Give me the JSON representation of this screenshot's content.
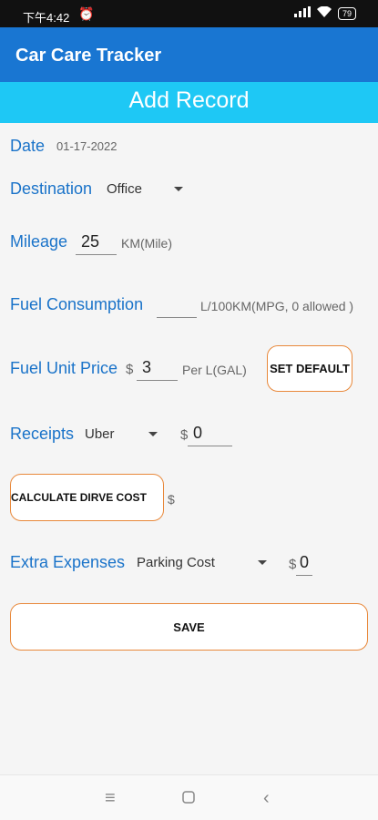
{
  "status_bar": {
    "time": "下午4:42",
    "alarm_icon": "⏰",
    "signal_icon": "▮▮▮",
    "wifi_icon": "wifi",
    "battery": "79"
  },
  "app_bar": {
    "title": "Car Care Tracker"
  },
  "banner": {
    "title": "Add Record"
  },
  "date": {
    "label": "Date",
    "value": "01-17-2022"
  },
  "destination": {
    "label": "Destination",
    "selected": "Office"
  },
  "mileage": {
    "label": "Mileage",
    "value": "25",
    "unit": "KM(Mile)"
  },
  "fuel_consumption": {
    "label": "Fuel Consumption",
    "value": "",
    "unit": "L/100KM(MPG, 0 allowed )"
  },
  "fuel_unit_price": {
    "label": "Fuel Unit Price",
    "currency": "$",
    "value": "3",
    "unit": "Per L(GAL)",
    "button": "SET DEFAULT"
  },
  "receipts": {
    "label": "Receipts",
    "selected": "Uber",
    "currency": "$",
    "value": "0"
  },
  "calculate": {
    "button": "CALCULATE DIRVE COST",
    "currency": "$"
  },
  "extra_expenses": {
    "label": "Extra Expenses",
    "selected": "Parking Cost",
    "currency": "$",
    "value": "0"
  },
  "save": {
    "button": "SAVE"
  },
  "nav_bar": {
    "menu_icon": "≡",
    "home_icon": "□",
    "back_icon": "<"
  },
  "colors": {
    "app_bar": "#1976d2",
    "banner": "#1ec8f5",
    "label": "#1a73c9",
    "accent_border": "#e8883a"
  }
}
